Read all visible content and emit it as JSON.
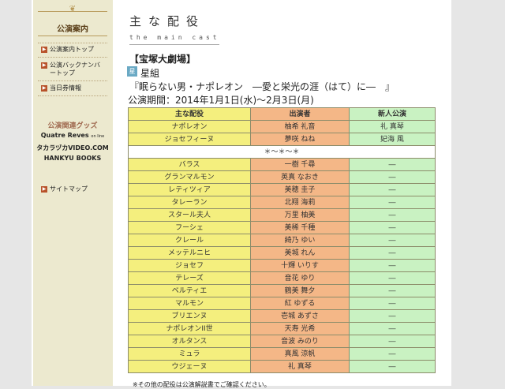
{
  "sidebar": {
    "header": "公演案内",
    "nav": [
      {
        "label": "公演案内トップ"
      },
      {
        "label": "公演バックナンバートップ"
      },
      {
        "label": "当日券情報"
      }
    ],
    "related_title": "公演関連グッズ",
    "related_links": [
      {
        "label": "Quatre Reves",
        "suffix": "on line"
      },
      {
        "label": "タカラヅカVIDEO.COM"
      },
      {
        "label": "HANKYU BOOKS"
      }
    ],
    "sitemap": "サイトマップ"
  },
  "main": {
    "title": "主な配役",
    "subtitle": "the main cast",
    "theater": "【宝塚大劇場】",
    "troupe_icon": "星",
    "troupe": "星組",
    "show_title": "『眠らない男・ナポレオン　―愛と栄光の涯（はて）に―　』",
    "period": "公演期間：2014年1月1日(水)～2月3日(月)",
    "separator": "＊～＊～＊",
    "bottom_note": "※その他の配役は公演解説書でご確認ください。"
  },
  "table": {
    "headers": [
      "主な配役",
      "出演者",
      "新人公演"
    ],
    "top_rows": [
      [
        "ナポレオン",
        "柚希 礼音",
        "礼 真琴"
      ],
      [
        "ジョセフィーヌ",
        "夢咲 ねね",
        "妃海 風"
      ]
    ],
    "rows": [
      [
        "バラス",
        "一樹 千尋",
        "―"
      ],
      [
        "グランマルモン",
        "英真 なおき",
        "―"
      ],
      [
        "レティツィア",
        "美穂 圭子",
        "―"
      ],
      [
        "タレーラン",
        "北翔 海莉",
        "―"
      ],
      [
        "スタール夫人",
        "万里 柚美",
        "―"
      ],
      [
        "フーシェ",
        "美稀 千種",
        "―"
      ],
      [
        "クレール",
        "綺乃 ゆい",
        "―"
      ],
      [
        "メッテルニヒ",
        "美城 れん",
        "―"
      ],
      [
        "ジョセフ",
        "十輝 いりす",
        "―"
      ],
      [
        "テレーズ",
        "音花 ゆり",
        "―"
      ],
      [
        "ベルティエ",
        "鶴美 舞夕",
        "―"
      ],
      [
        "マルモン",
        "紅 ゆずる",
        "―"
      ],
      [
        "ブリエンヌ",
        "壱城 あずさ",
        "―"
      ],
      [
        "ナポレオンII世",
        "天寿 光希",
        "―"
      ],
      [
        "オルタンス",
        "音波 みのり",
        "―"
      ],
      [
        "ミュラ",
        "真風 涼帆",
        "―"
      ],
      [
        "ウジェーヌ",
        "礼 真琴",
        "―"
      ]
    ]
  }
}
